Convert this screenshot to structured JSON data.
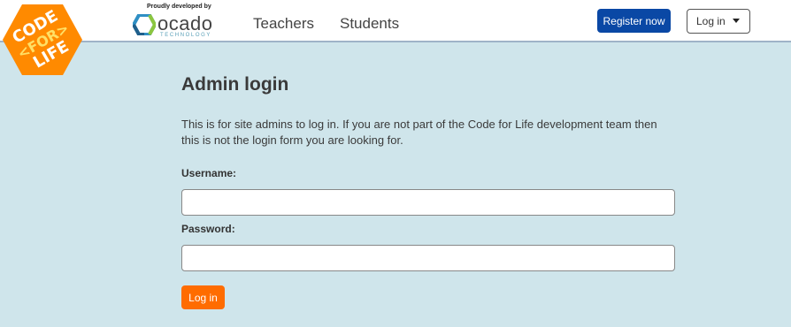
{
  "header": {
    "logo": {
      "icon": "code-for-life-logo",
      "line1": "CODE",
      "line2": "<FOR>",
      "line3": "LIFE",
      "color": "#ff8a00"
    },
    "developer": {
      "tagline": "Proudly developed by",
      "brand": "ocado",
      "sub": "TECHNOLOGY",
      "icon": "ocado-hexagon-icon"
    },
    "nav": {
      "teachers": "Teachers",
      "students": "Students"
    },
    "register_label": "Register now",
    "login_dropdown_label": "Log in"
  },
  "main": {
    "title": "Admin login",
    "intro": "This is for site admins to log in. If you are not part of the Code for Life development team then this is not the login form you are looking for.",
    "username_label": "Username:",
    "username_value": "",
    "password_label": "Password:",
    "password_value": "",
    "submit_label": "Log in"
  },
  "colors": {
    "background": "#cfe5eb",
    "register_button": "#0a48a5",
    "submit_button": "#ff6c00"
  }
}
